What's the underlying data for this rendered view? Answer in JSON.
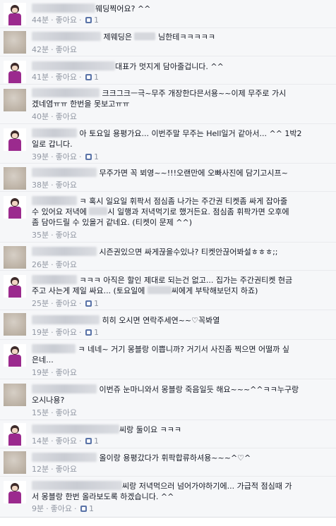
{
  "like_label": "좋아요",
  "sep": "·",
  "comments": [
    {
      "text": "웨딩찍어요? ^^",
      "time": "44분",
      "likes": "1",
      "avatar": "person"
    },
    {
      "text": "제웨딩은",
      "text2": "님한테ㅋㅋㅋㅋㅋ",
      "time": "42분",
      "likes": "",
      "avatar": "blur"
    },
    {
      "text": "대표가 멋지게 담아줄겁니다. ^^",
      "time": "41분",
      "likes": "1",
      "avatar": "person"
    },
    {
      "text": "크크그크ㅡ극~무주 개장한다믄서용~~이제 무주로 가시",
      "line2": "겠네염ㅠㅠ 한번을 못보고ㅠㅠ",
      "time": "40분",
      "likes": "",
      "avatar": "blur"
    },
    {
      "text": "아 토요일 용평가요... 이번주말 무주는 Hell일거 같아서... ^^ 1박2",
      "line2": "일로 갑니다.",
      "time": "39분",
      "likes": "1",
      "avatar": "person"
    },
    {
      "text": "무주가면 꼭 뵈영~~!!!오랜만에 오빠사진에 담기고시프~",
      "time": "38분",
      "likes": "",
      "avatar": "blur"
    },
    {
      "text": "ㅋ 혹시 일요일 휘팍서 점심좀 나가는 주간권 티켓좀 싸게 잡아줄",
      "line2": "수 있어요 저녁에",
      "line2b": "시 일행과 저녁먹기로 했거든요. 점심좀 휘팍가면 오후에",
      "line3": "좀 담아드릴 수 있을거 같네요. (티켓이 문제 ^^)",
      "time": "35분",
      "likes": "",
      "avatar": "person"
    },
    {
      "text": "시즌권있으면 싸게끊을수있나? 티켓안끊어봐설ㅎㅎㅎ;;",
      "time": "26분",
      "likes": "",
      "avatar": "blur"
    },
    {
      "text": "ㅋㅋㅋ 아직은 할인 제대로 되는건 없고... 집가는 주간권티켓 현금",
      "line2": "주고 사는게 제일 싸요... (토요일에",
      "line2b": "씨에게 부탁해보던지 하죠)",
      "time": "25분",
      "likes": "1",
      "avatar": "person"
    },
    {
      "text": "히히 오시면 연락주세연~~♡꼭봐열",
      "time": "19분",
      "likes": "1",
      "avatar": "blur"
    },
    {
      "text": "ㅋ 네네~ 거기 몽블랑 이쁩니까? 거기서 사진좀 찍으면 어떨까 싶",
      "line2": "은네...",
      "time": "19분",
      "likes": "",
      "avatar": "person"
    },
    {
      "text": "이번쥬 눈마니와서 몽블랑 죽음일듯 해요~~~^^ㅋㅋ누구랑",
      "line2": "오시나용?",
      "time": "15분",
      "likes": "",
      "avatar": "blur"
    },
    {
      "text": "씨랑 둘이요 ㅋㅋㅋ",
      "time": "14분",
      "likes": "1",
      "avatar": "person"
    },
    {
      "text": "올이랑 용평갔다가 휘팍합류하셔용~~~^♡^",
      "time": "12분",
      "likes": "",
      "avatar": "blur"
    },
    {
      "text": "씨랑 저녁먹으러 넘어가야하기에... 가급적 점심때 가",
      "line2": "서 몽블랑 한번 올라보도록 하겠습니다. ^^",
      "time": "9분",
      "likes": "1",
      "avatar": "person"
    }
  ]
}
